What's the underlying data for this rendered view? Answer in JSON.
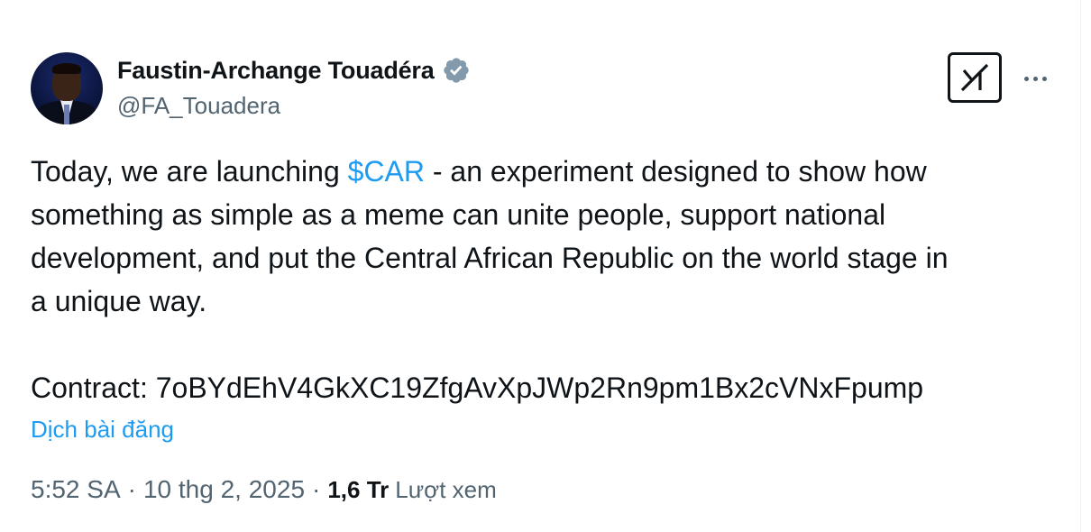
{
  "author": {
    "display_name": "Faustin-Archange Touadéra",
    "handle": "@FA_Touadera",
    "verified": true,
    "verified_badge_color": "#829aab"
  },
  "header_actions": {
    "grok_icon": "grok-icon",
    "more_icon": "more-dots-icon"
  },
  "tweet": {
    "line1_before": "Today, we are launching ",
    "cashtag": "$CAR",
    "line1_after": " - an experiment designed to show how",
    "line2": "something as simple as a meme can unite people, support national",
    "line3": "development, and put the Central African Republic on the world stage in",
    "line4": "a unique way.",
    "contract": "Contract: 7oBYdEhV4GkXC19ZfgAvXpJWp2Rn9pm1Bx2cVNxFpump"
  },
  "translate_label": "Dịch bài đăng",
  "meta": {
    "time": "5:52 SA",
    "date": "10 thg 2, 2025",
    "separator": "·",
    "views_count": "1,6 Tr",
    "views_label": "Lượt xem"
  },
  "colors": {
    "text": "#0f1419",
    "secondary": "#536471",
    "link": "#1d9bf0"
  }
}
